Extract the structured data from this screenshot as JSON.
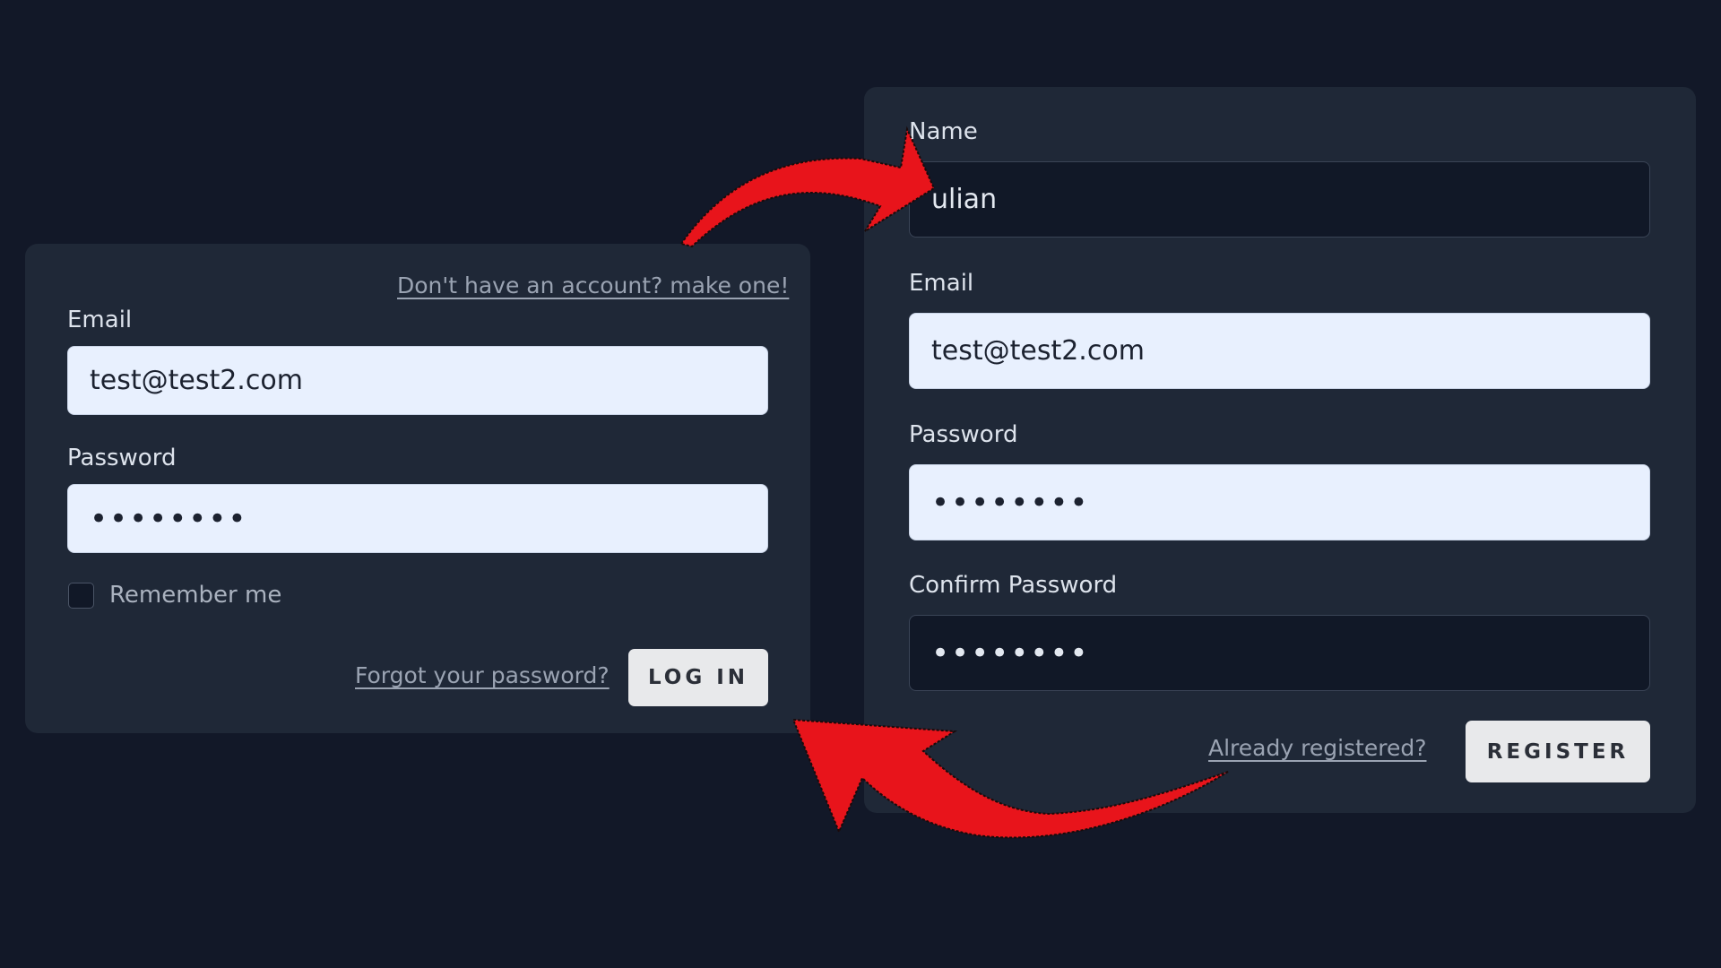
{
  "login": {
    "register_link": "Don't have an account? make one!",
    "email_label": "Email",
    "email_value": "test@test2.com",
    "password_label": "Password",
    "password_value": "••••••••",
    "remember_label": "Remember me",
    "remember_checked": false,
    "forgot_link": "Forgot your password?",
    "login_button": "LOG IN"
  },
  "register": {
    "name_label": "Name",
    "name_value": "ulian",
    "email_label": "Email",
    "email_value": "test@test2.com",
    "password_label": "Password",
    "password_value": "••••••••",
    "confirm_label": "Confirm Password",
    "confirm_value": "••••••••",
    "already_link": "Already registered?",
    "register_button": "REGISTER"
  },
  "colors": {
    "background": "#121828",
    "card": "#1f2837",
    "input_light": "#e8f0fe",
    "input_dark": "#111827",
    "arrow": "#e8141b"
  },
  "annotations": {
    "arrow_top": "red-arrow pointing from login card to register name field",
    "arrow_bottom": "red-arrow pointing from register link to login card"
  }
}
